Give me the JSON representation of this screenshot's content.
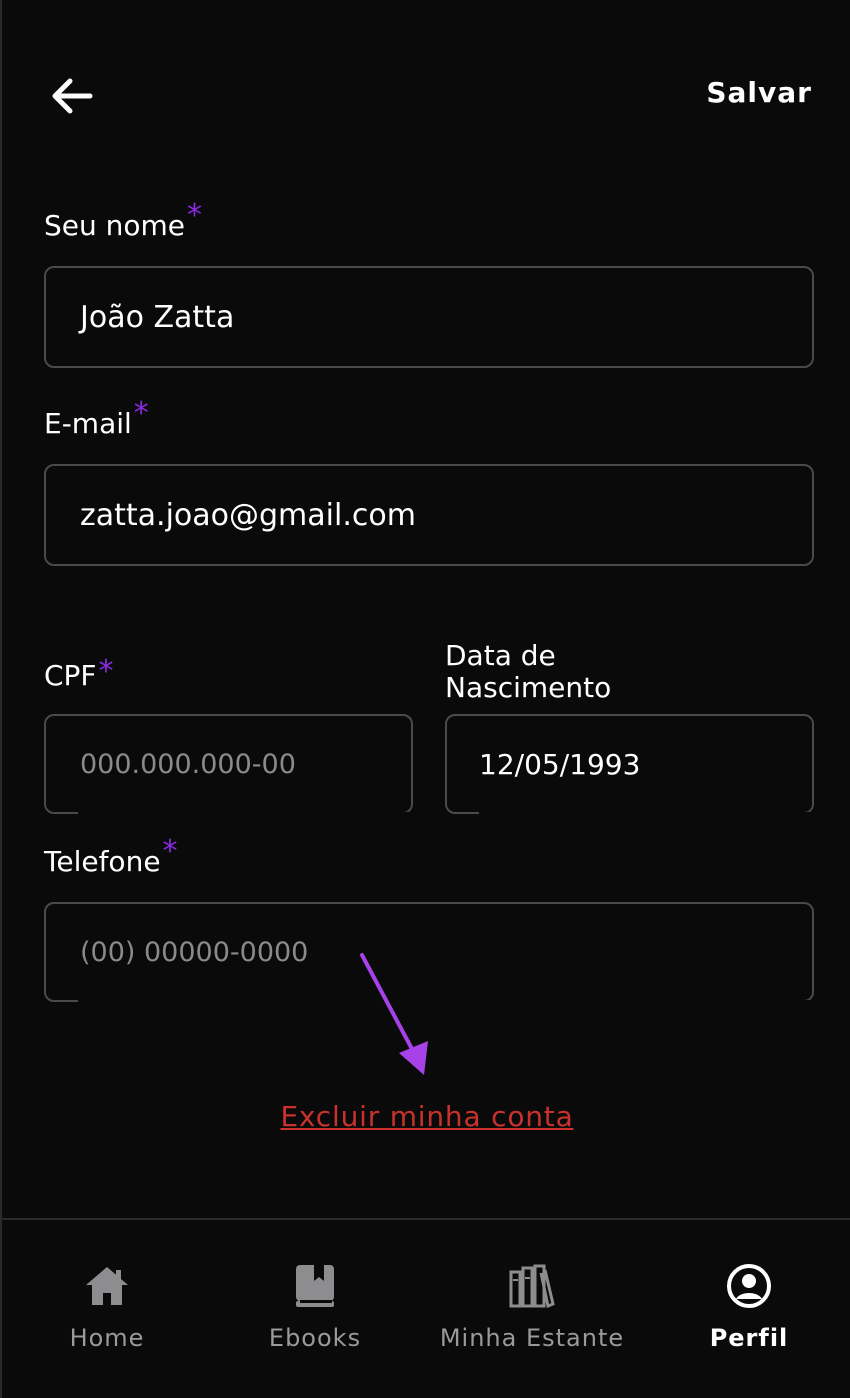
{
  "header": {
    "back_icon": "arrow-left-icon",
    "save_label": "Salvar"
  },
  "form": {
    "name": {
      "label": "Seu nome",
      "required_mark": "*",
      "value": "João Zatta"
    },
    "email": {
      "label": "E-mail",
      "required_mark": "*",
      "value": "zatta.joao@gmail.com"
    },
    "cpf": {
      "label": "CPF",
      "required_mark": "*",
      "value": "",
      "placeholder": "000.000.000-00"
    },
    "birth": {
      "label_line1": "Data de",
      "label_line2": "Nascimento",
      "value": "12/05/1993"
    },
    "phone": {
      "label": "Telefone",
      "required_mark": "*",
      "value": "",
      "placeholder": "(00) 00000-0000"
    }
  },
  "delete_account_label": "Excluir minha conta",
  "annotation": {
    "arrow_color": "#a742e8"
  },
  "colors": {
    "background": "#0a0a0b",
    "required": "#8a2be2",
    "danger": "#c8312c",
    "inactive_nav": "#9a9a9c"
  },
  "bottom_nav": {
    "items": [
      {
        "label": "Home",
        "icon": "home-icon",
        "active": false
      },
      {
        "label": "Ebooks",
        "icon": "book-icon",
        "active": false
      },
      {
        "label": "Minha Estante",
        "icon": "bookshelf-icon",
        "active": false
      },
      {
        "label": "Perfil",
        "icon": "user-circle-icon",
        "active": true
      }
    ]
  }
}
